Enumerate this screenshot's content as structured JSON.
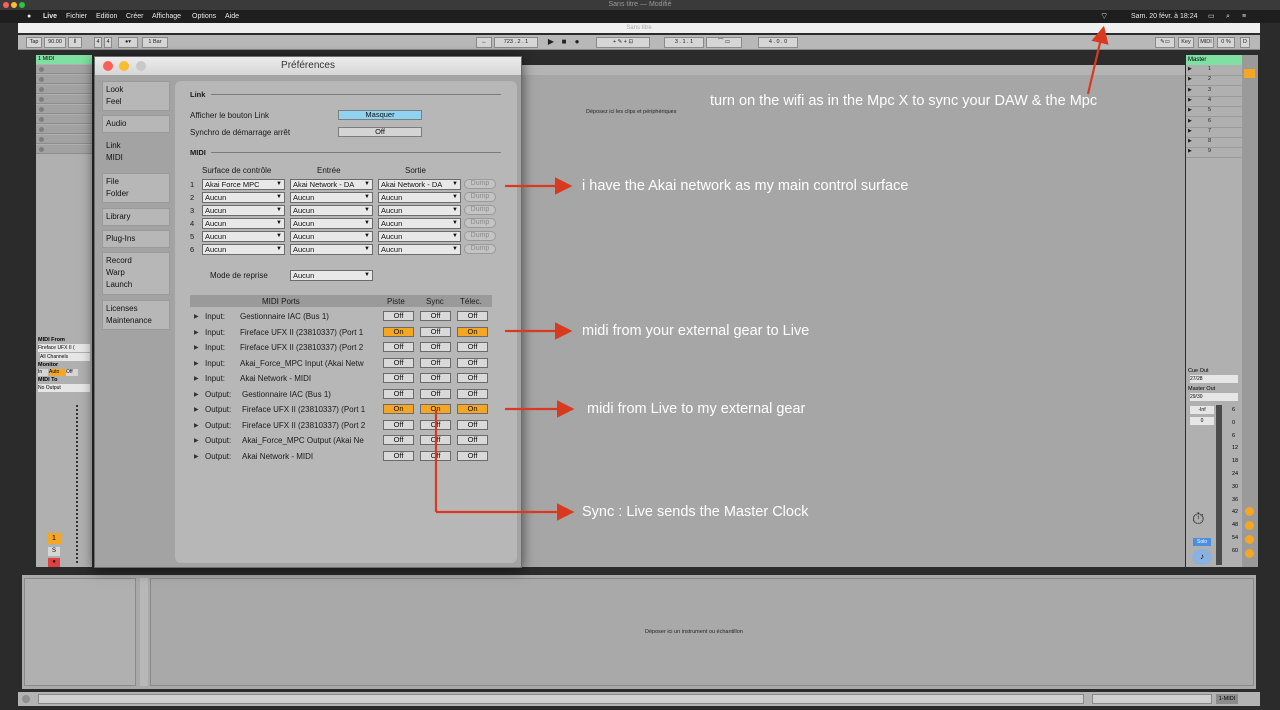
{
  "window": {
    "title": "Sans titre — Modifié",
    "inner_title": "Sans titre"
  },
  "menubar": {
    "app": "Live",
    "items": [
      "Fichier",
      "Edition",
      "Créer",
      "Affichage",
      "Options",
      "Aide"
    ],
    "clock": "Sam. 20 févr. à 18:24"
  },
  "toolbar": {
    "tap": "Tap",
    "tempo": "90.00",
    "sig_num": "4",
    "sig_den": "4",
    "quant": "1 Bar",
    "position": "723 .  2 .  1",
    "loop_start": "3 .  1 .  1",
    "loop_len": "4 .  0 .  0",
    "key": "Key",
    "midi": "MIDI",
    "cpu": "0 %",
    "d": "D"
  },
  "left_panel": {
    "track": "1 MIDI",
    "midi_from_label": "MIDI From",
    "midi_from_value": "Fireface UFX II (",
    "channels": "All Channels",
    "monitor_label": "Monitor",
    "monitor": [
      "In",
      "Auto",
      "Off"
    ],
    "midi_to_label": "MIDI To",
    "midi_to_value": "No Output",
    "track_num": "1",
    "s": "S"
  },
  "center": {
    "drop_hint": "Déposez ici les clips et périphériques"
  },
  "master": {
    "title": "Master",
    "scenes": [
      "1",
      "2",
      "3",
      "4",
      "5",
      "6",
      "7",
      "8",
      "9"
    ],
    "cue_out_label": "Cue Out",
    "cue_out": "27/28",
    "master_out_label": "Master Out",
    "master_out": "29/30",
    "inf": "-Inf",
    "zero": "0",
    "meter_ticks": [
      "6",
      "0",
      "6",
      "12",
      "18",
      "24",
      "30",
      "36",
      "42",
      "48",
      "54",
      "60"
    ],
    "solo": "Solo"
  },
  "bottom": {
    "drop_hint": "Déposer ici un instrument ou échantillon",
    "status_track": "1-MIDI"
  },
  "prefs": {
    "title": "Préférences",
    "tabs": [
      {
        "l1": "Look",
        "l2": "Feel"
      },
      {
        "l1": "Audio",
        "l2": ""
      },
      {
        "l1": "Link",
        "l2": "MIDI"
      },
      {
        "l1": "File",
        "l2": "Folder"
      },
      {
        "l1": "Library",
        "l2": ""
      },
      {
        "l1": "Plug-Ins",
        "l2": ""
      },
      {
        "l1": "Record",
        "l2": "Warp",
        "l3": "Launch"
      },
      {
        "l1": "Licenses",
        "l2": "Maintenance"
      }
    ],
    "link_header": "Link",
    "show_link_label": "Afficher le bouton Link",
    "show_link_value": "Masquer",
    "start_stop_label": "Synchro de démarrage arrêt",
    "start_stop_value": "Off",
    "midi_header": "MIDI",
    "col_surface": "Surface de contrôle",
    "col_input": "Entrée",
    "col_output": "Sortie",
    "surfaces": [
      {
        "n": "1",
        "surface": "Akai Force MPC",
        "input": "Akai Network - DA",
        "output": "Akai Network - DA"
      },
      {
        "n": "2",
        "surface": "Aucun",
        "input": "Aucun",
        "output": "Aucun"
      },
      {
        "n": "3",
        "surface": "Aucun",
        "input": "Aucun",
        "output": "Aucun"
      },
      {
        "n": "4",
        "surface": "Aucun",
        "input": "Aucun",
        "output": "Aucun"
      },
      {
        "n": "5",
        "surface": "Aucun",
        "input": "Aucun",
        "output": "Aucun"
      },
      {
        "n": "6",
        "surface": "Aucun",
        "input": "Aucun",
        "output": "Aucun"
      }
    ],
    "dump": "Dump",
    "takeover_label": "Mode de reprise",
    "takeover_value": "Aucun",
    "ports_header": "MIDI Ports",
    "col_track": "Piste",
    "col_sync": "Sync",
    "col_remote": "Télec.",
    "ports": [
      {
        "dir": "Input:",
        "name": "Gestionnaire IAC (Bus 1)",
        "track": "Off",
        "sync": "Off",
        "remote": "Off"
      },
      {
        "dir": "Input:",
        "name": "Fireface UFX II (23810337) (Port 1",
        "track": "On",
        "sync": "Off",
        "remote": "On"
      },
      {
        "dir": "Input:",
        "name": "Fireface UFX II (23810337) (Port 2",
        "track": "Off",
        "sync": "Off",
        "remote": "Off"
      },
      {
        "dir": "Input:",
        "name": "Akai_Force_MPC Input (Akai Netw",
        "track": "Off",
        "sync": "Off",
        "remote": "Off"
      },
      {
        "dir": "Input:",
        "name": "Akai Network - MIDI",
        "track": "Off",
        "sync": "Off",
        "remote": "Off"
      },
      {
        "dir": "Output:",
        "name": "Gestionnaire IAC (Bus 1)",
        "track": "Off",
        "sync": "Off",
        "remote": "Off"
      },
      {
        "dir": "Output:",
        "name": "Fireface UFX II (23810337) (Port 1",
        "track": "On",
        "sync": "On",
        "remote": "On"
      },
      {
        "dir": "Output:",
        "name": "Fireface UFX II (23810337) (Port 2",
        "track": "Off",
        "sync": "Off",
        "remote": "Off"
      },
      {
        "dir": "Output:",
        "name": "Akai_Force_MPC Output (Akai Ne",
        "track": "Off",
        "sync": "Off",
        "remote": "Off"
      },
      {
        "dir": "Output:",
        "name": "Akai Network - MIDI",
        "track": "Off",
        "sync": "Off",
        "remote": "Off"
      }
    ]
  },
  "annotations": {
    "wifi": "turn on the wifi as in the Mpc X to sync your DAW & the Mpc",
    "akai": "i have the Akai network as my main control surface",
    "midi_in": "midi from your external gear to Live",
    "midi_out": "midi from Live to my external gear",
    "sync": "Sync : Live sends the Master Clock"
  },
  "colors": {
    "accent_on": "#f5a623",
    "arrow": "#d93a1f",
    "link_button": "#8fd3f0",
    "master_header": "#7ee0a2"
  }
}
